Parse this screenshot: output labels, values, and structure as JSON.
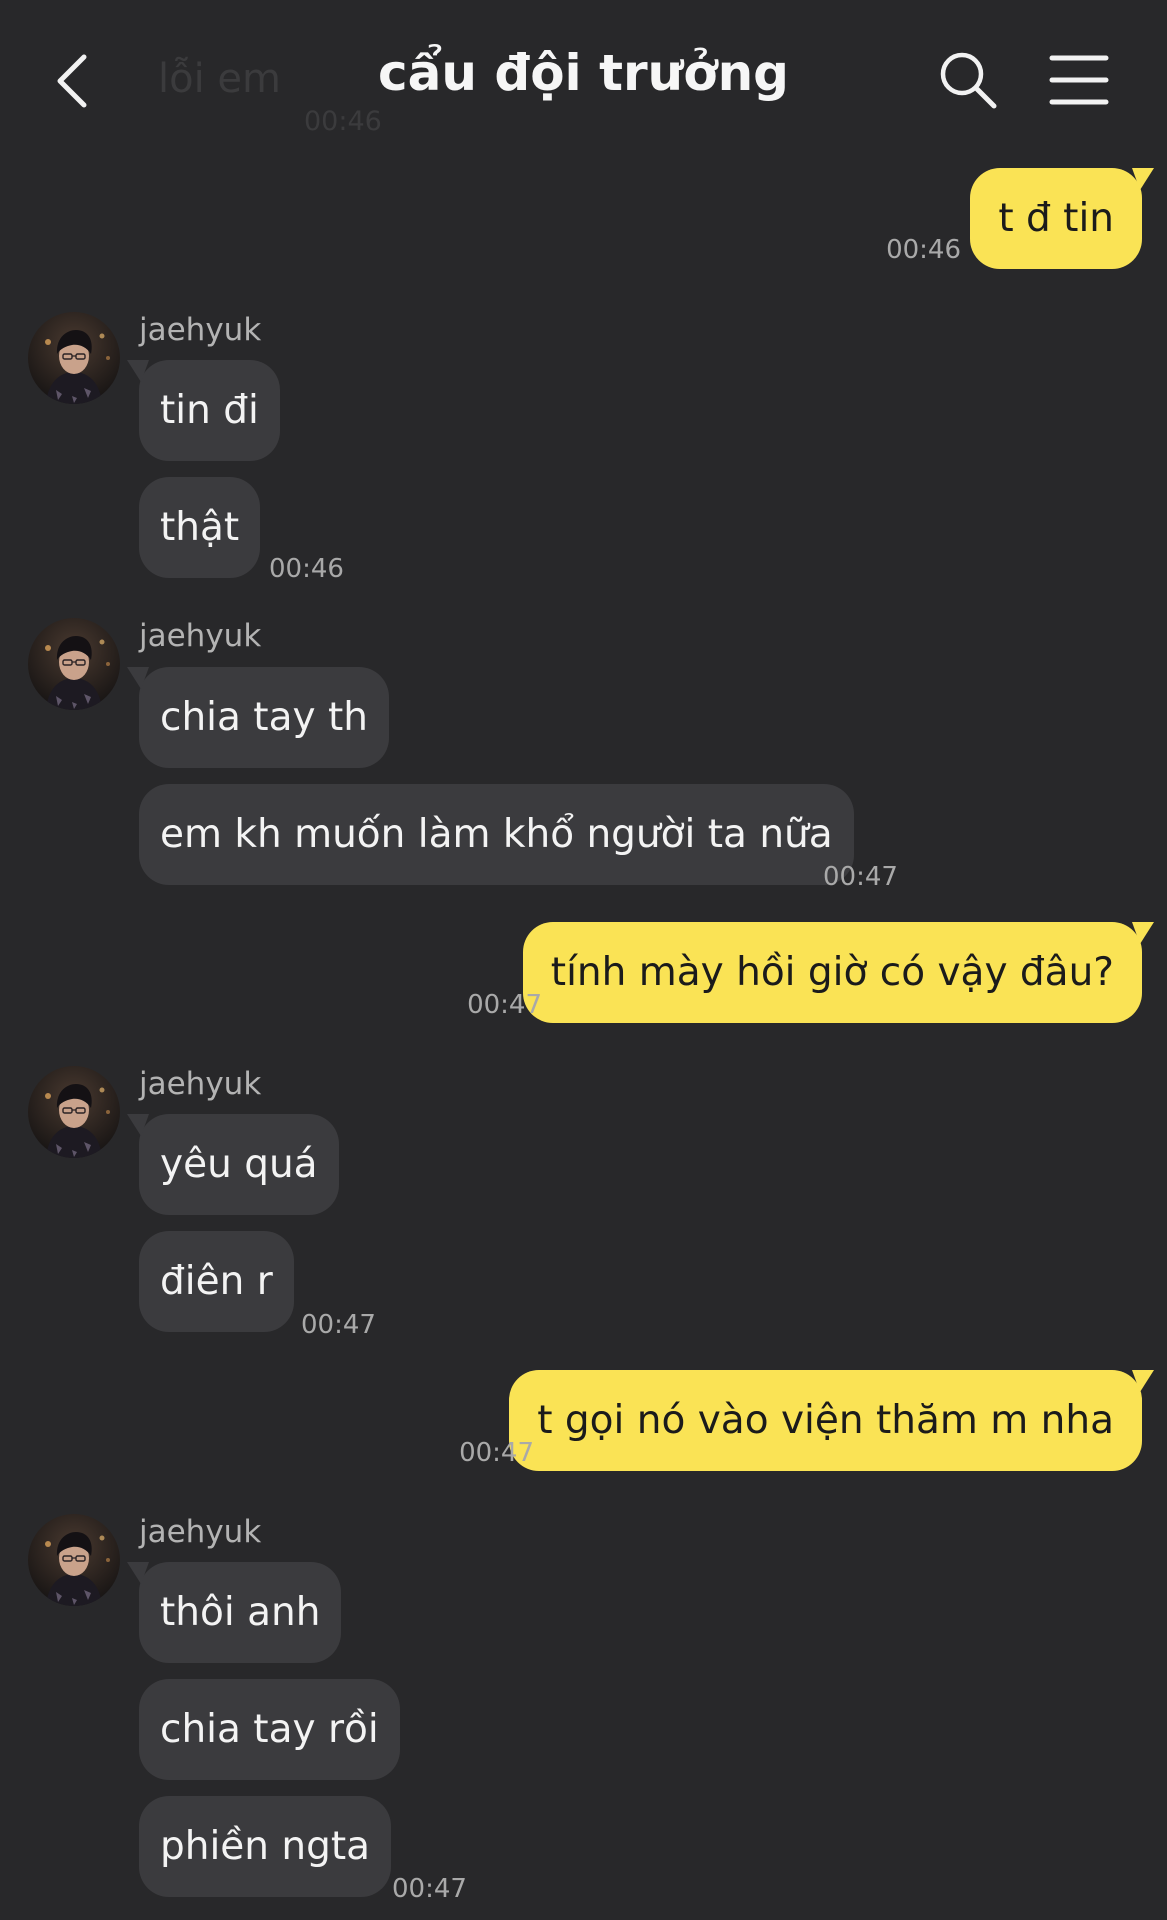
{
  "header": {
    "title": "cẩu đội trưởng",
    "ghost_text": "lỗi em",
    "ghost_time": "00:46"
  },
  "messages": [
    {
      "from": "me",
      "text": "t đ tin",
      "time": "00:46"
    },
    {
      "from": "jaehyuk",
      "sender": "jaehyuk",
      "texts": [
        "tin đi",
        "thật"
      ],
      "time": "00:46"
    },
    {
      "from": "jaehyuk",
      "sender": "jaehyuk",
      "texts": [
        "chia tay th",
        "em kh muốn làm khổ người ta nữa"
      ],
      "time": "00:47"
    },
    {
      "from": "me",
      "text": "tính mày hồi giờ có vậy đâu?",
      "time": "00:47"
    },
    {
      "from": "jaehyuk",
      "sender": "jaehyuk",
      "texts": [
        "yêu quá",
        "điên r"
      ],
      "time": "00:47"
    },
    {
      "from": "me",
      "text": "t gọi nó vào viện thăm m nha",
      "time": "00:47"
    },
    {
      "from": "jaehyuk",
      "sender": "jaehyuk",
      "texts": [
        "thôi anh",
        "chia tay rồi",
        "phiền ngta"
      ],
      "time": "00:47"
    }
  ],
  "colors": {
    "background": "#28282a",
    "incoming_bubble": "#3b3b3e",
    "outgoing_bubble": "#fae355",
    "timestamp": "#a9a9a9"
  },
  "icons": [
    "back-arrow-icon",
    "search-icon",
    "menu-icon"
  ]
}
